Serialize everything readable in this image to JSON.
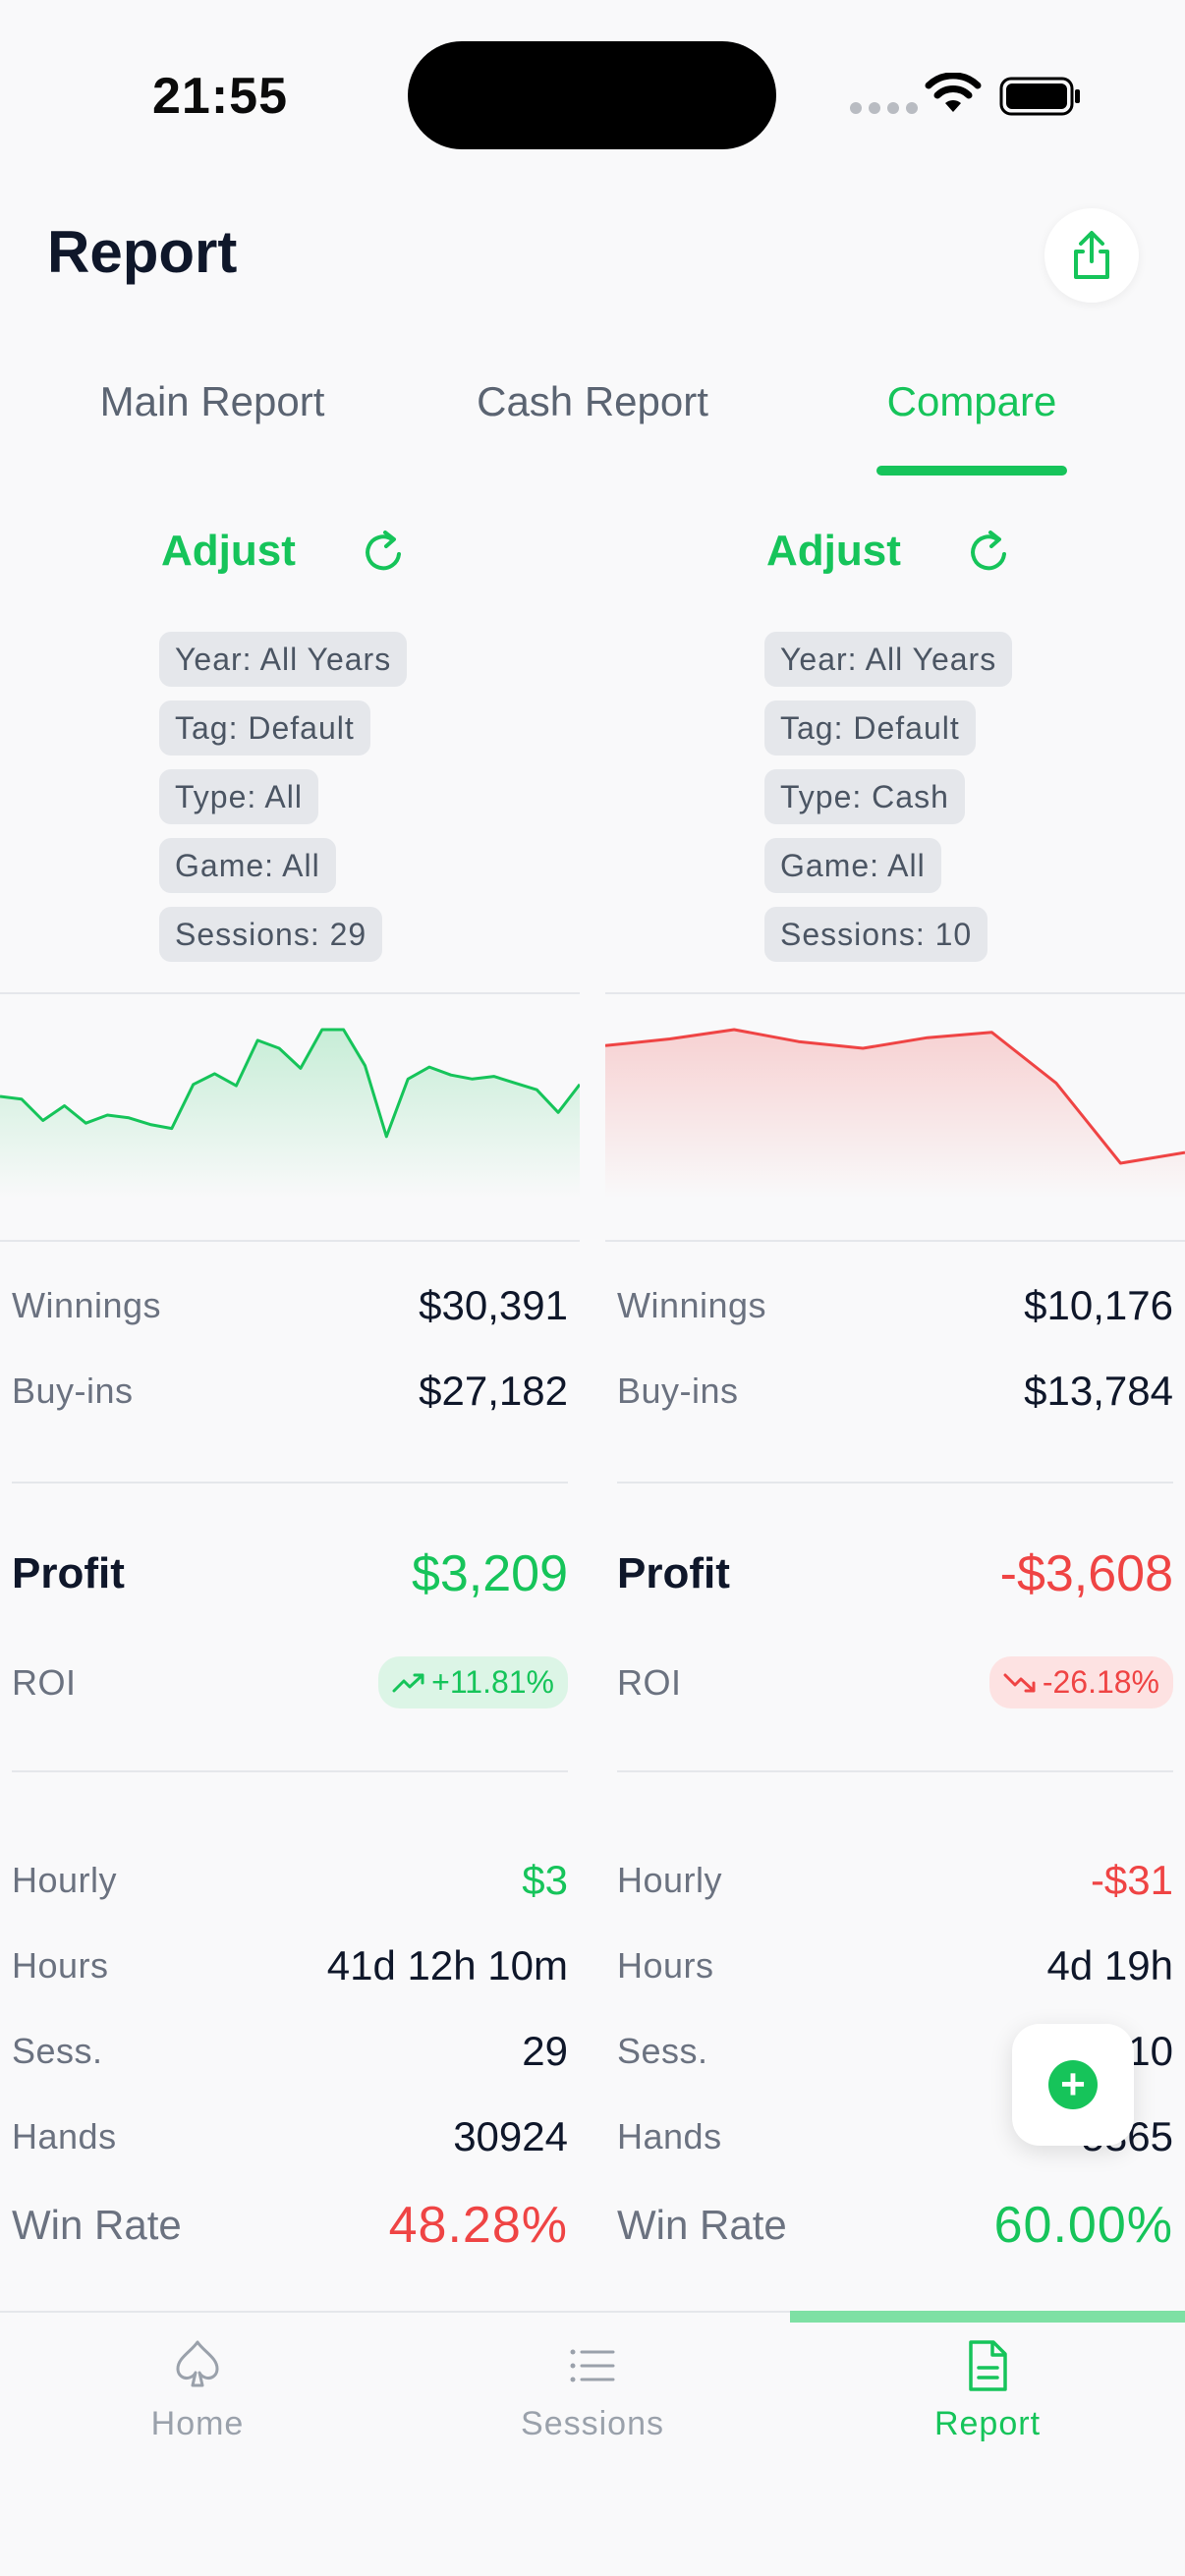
{
  "status_bar": {
    "time": "21:55"
  },
  "header": {
    "title": "Report"
  },
  "tabs": [
    {
      "label": "Main Report"
    },
    {
      "label": "Cash Report"
    },
    {
      "label": "Compare"
    }
  ],
  "colors": {
    "accent": "#16c45a",
    "negative": "#ef4444",
    "chip_bg": "#e5e7eb"
  },
  "left": {
    "adjust_label": "Adjust",
    "filters": [
      "Year: All Years",
      "Tag: Default",
      "Type: All",
      "Game: All",
      "Sessions: 29"
    ],
    "chart_trend": [
      0.5,
      0.48,
      0.32,
      0.43,
      0.3,
      0.36,
      0.34,
      0.29,
      0.26,
      0.59,
      0.67,
      0.58,
      0.92,
      0.86,
      0.71,
      1.0,
      1.0,
      0.73,
      0.2,
      0.63,
      0.72,
      0.66,
      0.63,
      0.65,
      0.6,
      0.55,
      0.38,
      0.59
    ],
    "winnings_label": "Winnings",
    "winnings": "$30,391",
    "buyins_label": "Buy-ins",
    "buyins": "$27,182",
    "profit_label": "Profit",
    "profit": "$3,209",
    "roi_label": "ROI",
    "roi": "+11.81%",
    "hourly_label": "Hourly",
    "hourly": "$3",
    "hours_label": "Hours",
    "hours": "41d 12h 10m",
    "sess_label": "Sess.",
    "sess": "29",
    "hands_label": "Hands",
    "hands": "30924",
    "winrate_label": "Win Rate",
    "winrate": "48.28%"
  },
  "right": {
    "adjust_label": "Adjust",
    "filters": [
      "Year: All Years",
      "Tag: Default",
      "Type: Cash",
      "Game: All",
      "Sessions: 10"
    ],
    "chart_trend": [
      0.88,
      0.93,
      1.0,
      0.91,
      0.86,
      0.94,
      0.98,
      0.6,
      0.0,
      0.08
    ],
    "winnings_label": "Winnings",
    "winnings": "$10,176",
    "buyins_label": "Buy-ins",
    "buyins": "$13,784",
    "profit_label": "Profit",
    "profit": "-$3,608",
    "roi_label": "ROI",
    "roi": "-26.18%",
    "hourly_label": "Hourly",
    "hourly": "-$31",
    "hours_label": "Hours",
    "hours": "4d 19h",
    "sess_label": "Sess.",
    "sess": "10",
    "hands_label": "Hands",
    "hands": "5365",
    "winrate_label": "Win Rate",
    "winrate": "60.00%"
  },
  "nav": [
    {
      "label": "Home",
      "icon": "spade-icon"
    },
    {
      "label": "Sessions",
      "icon": "list-icon"
    },
    {
      "label": "Report",
      "icon": "document-icon"
    }
  ]
}
